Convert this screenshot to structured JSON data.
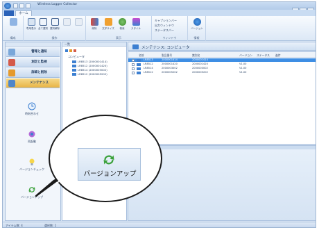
{
  "app": {
    "title": "Wireless Logger Collector",
    "file_tab": "",
    "home_tab": "ホーム"
  },
  "ribbon": {
    "groups": [
      {
        "label": "構成"
      },
      {
        "label": "操作"
      },
      {
        "label": "表示"
      },
      {
        "label": "ウィンドウ"
      },
      {
        "label": "情報"
      }
    ],
    "buttons": [
      {
        "label": "グループ",
        "icon": "group-icon"
      },
      {
        "label": "専用表示",
        "icon": "dedicated-view-icon"
      },
      {
        "label": "全て選択",
        "icon": "select-all-icon"
      },
      {
        "label": "選択解除",
        "icon": "deselect-icon"
      },
      {
        "label": "",
        "icon": "disabled-icon"
      },
      {
        "label": "",
        "icon": "disabled-icon"
      },
      {
        "label": "削除",
        "icon": "delete-icon"
      },
      {
        "label": "文字サイズ",
        "icon": "font-size-icon"
      },
      {
        "label": "検索",
        "icon": "search-icon"
      },
      {
        "label": "スタイル",
        "icon": "style-icon"
      },
      {
        "label": "バージョン",
        "icon": "info-icon"
      }
    ],
    "window_checks": [
      "キャプションバー",
      "出力ウィンドウ",
      "ステータスバー"
    ]
  },
  "sidebar": {
    "nav": [
      {
        "label": "警報と通知",
        "icon": "alarm-icon"
      },
      {
        "label": "測定と監視",
        "icon": "monitor-icon"
      },
      {
        "label": "詳細と削除",
        "icon": "detail-icon"
      },
      {
        "label": "メンテナンス",
        "icon": "maintenance-icon"
      }
    ],
    "tools": [
      {
        "label": "時刻合わせ",
        "icon": "clock-icon"
      },
      {
        "label": "再起動",
        "icon": "restart-icon"
      },
      {
        "label": "バージョンチェック",
        "icon": "version-check-icon"
      },
      {
        "label": "バージョンアップ",
        "icon": "version-up-icon"
      }
    ]
  },
  "tree": {
    "header": "一覧",
    "root": "コンピュータ",
    "items": [
      "LR8513 (2000001414)",
      "LR8512 (2000001420)",
      "LR8514 (2000003002)",
      "LR8512 (2000005202)"
    ]
  },
  "main": {
    "title": "メンテナンス: コンピュータ",
    "columns": [
      "名前",
      "製品番号",
      "識別名",
      "バージョン",
      "ステータス",
      "進捗"
    ],
    "rows": [
      {
        "name": "LR8513",
        "serial": "2000001414",
        "id": "2000001414",
        "version": "",
        "selected": true
      },
      {
        "name": "LR8512",
        "serial": "2000001420",
        "id": "2000001420",
        "version": "V1.00",
        "selected": false
      },
      {
        "name": "LR8514",
        "serial": "2000003002",
        "id": "2000003002",
        "version": "V1.00",
        "selected": false
      },
      {
        "name": "LR8512",
        "serial": "2000005202",
        "id": "2000005202",
        "version": "V1.00",
        "selected": false
      }
    ]
  },
  "status": {
    "items": [
      "アイテム数: 4",
      "選択数: 1"
    ]
  },
  "zoom": {
    "label": "バージョンアップ",
    "icon": "version-up-icon"
  },
  "colors": {
    "accent": "#3e8ee4",
    "active_nav": "#e9b445",
    "ribbon_bg": "#dce8f6"
  }
}
